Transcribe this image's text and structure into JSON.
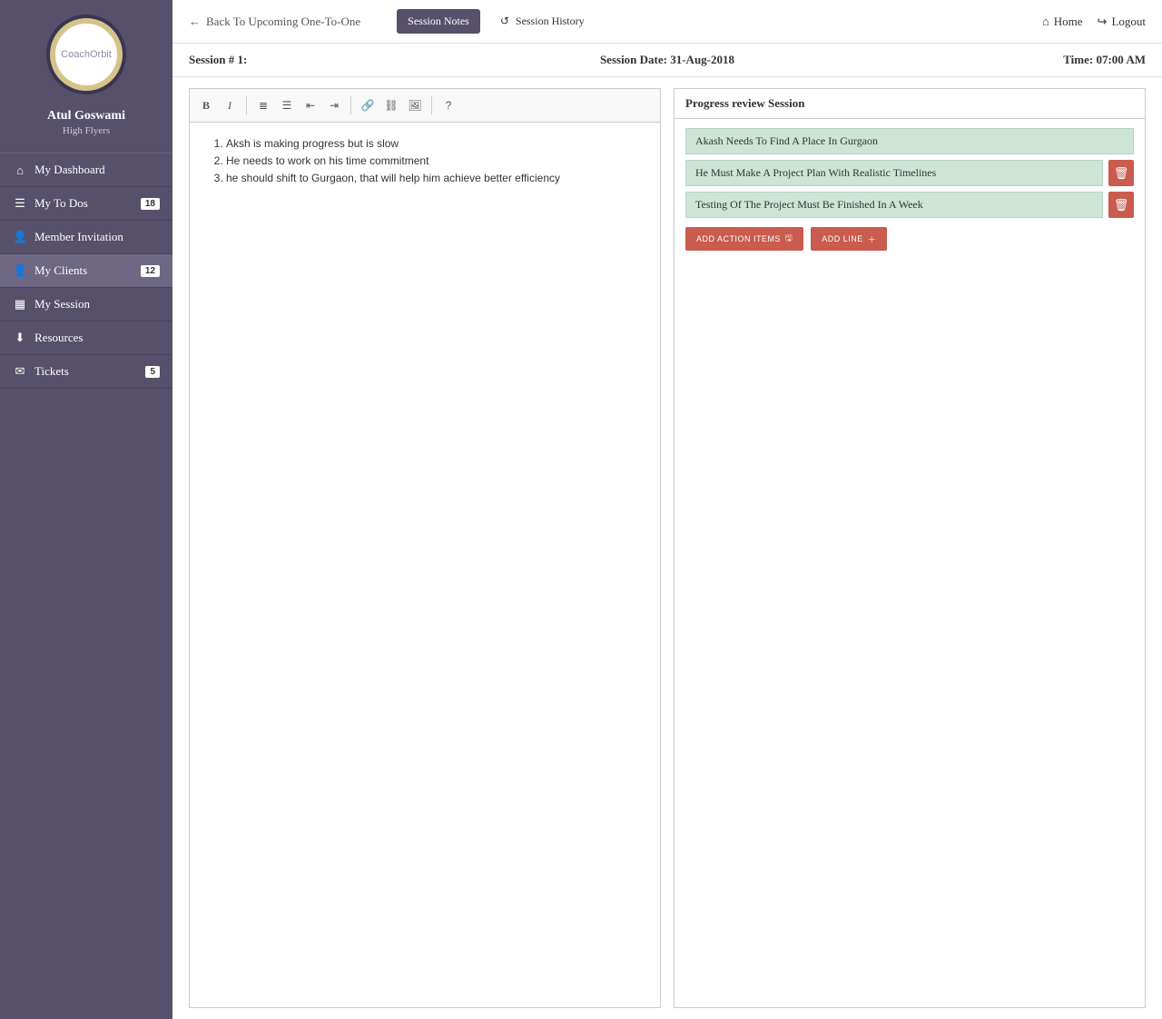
{
  "brand": "CoachOrbit",
  "user": {
    "name": "Atul Goswami",
    "role": "High Flyers"
  },
  "nav": {
    "dashboard": "My Dashboard",
    "todos": "My To Dos",
    "todos_badge": "18",
    "invitation": "Member Invitation",
    "clients": "My Clients",
    "clients_badge": "12",
    "session": "My Session",
    "resources": "Resources",
    "tickets": "Tickets",
    "tickets_badge": "5"
  },
  "topbar": {
    "back": "Back To Upcoming One-To-One",
    "tab_notes": "Session Notes",
    "tab_history": "Session History",
    "home": "Home",
    "logout": "Logout"
  },
  "session": {
    "number_label": "Session # 1:",
    "date_label": "Session Date: 31-Aug-2018",
    "time_label": "Time: 07:00 AM"
  },
  "notes": {
    "items": [
      "Aksh is making progress but is slow",
      "He needs to work on his time commitment",
      "he should shift to Gurgaon, that will help him achieve better efficiency"
    ]
  },
  "progress": {
    "title": "Progress review Session",
    "items": [
      "Akash Needs To Find A Place In Gurgaon",
      "He Must Make A Project Plan With Realistic Timelines",
      "Testing Of The Project Must Be Finished In A Week"
    ],
    "add_action_label": "ADD ACTION ITEMS",
    "add_line_label": "ADD LINE"
  }
}
